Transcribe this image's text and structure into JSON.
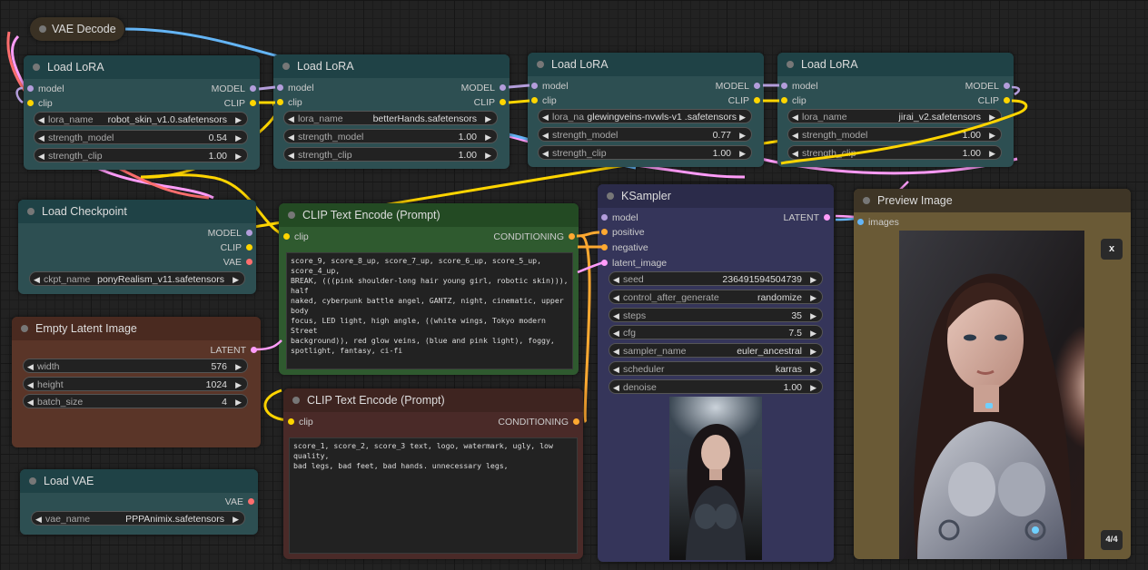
{
  "colors": {
    "model": "#b39ddb",
    "clip": "#ffd500",
    "vae": "#ff6e6e",
    "latent": "#ff9cf9",
    "conditioning": "#ffa931",
    "image": "#64b5f6"
  },
  "vae_decode": {
    "title": "VAE Decode"
  },
  "lora1": {
    "title": "Load LoRA",
    "in_model": "model",
    "in_clip": "clip",
    "out_model": "MODEL",
    "out_clip": "CLIP",
    "w_name_label": "lora_name",
    "w_name_value": "robot_skin_v1.0.safetensors",
    "w_sm_label": "strength_model",
    "w_sm_value": "0.54",
    "w_sc_label": "strength_clip",
    "w_sc_value": "1.00"
  },
  "lora2": {
    "title": "Load LoRA",
    "in_model": "model",
    "in_clip": "clip",
    "out_model": "MODEL",
    "out_clip": "CLIP",
    "w_name_label": "lora_name",
    "w_name_value": "betterHands.safetensors",
    "w_sm_label": "strength_model",
    "w_sm_value": "1.00",
    "w_sc_label": "strength_clip",
    "w_sc_value": "1.00"
  },
  "lora3": {
    "title": "Load LoRA",
    "in_model": "model",
    "in_clip": "clip",
    "out_model": "MODEL",
    "out_clip": "CLIP",
    "w_name_label": "lora_na",
    "w_name_value": "glewingveins-nvwls-v1 .safetensors",
    "w_sm_label": "strength_model",
    "w_sm_value": "0.77",
    "w_sc_label": "strength_clip",
    "w_sc_value": "1.00"
  },
  "lora4": {
    "title": "Load LoRA",
    "in_model": "model",
    "in_clip": "clip",
    "out_model": "MODEL",
    "out_clip": "CLIP",
    "w_name_label": "lora_name",
    "w_name_value": "jirai_v2.safetensors",
    "w_sm_label": "strength_model",
    "w_sm_value": "1.00",
    "w_sc_label": "strength_clip",
    "w_sc_value": "1.00"
  },
  "checkpoint": {
    "title": "Load Checkpoint",
    "out_model": "MODEL",
    "out_clip": "CLIP",
    "out_vae": "VAE",
    "w_label": "ckpt_name",
    "w_value": "ponyRealism_v11.safetensors"
  },
  "latent": {
    "title": "Empty Latent Image",
    "out_latent": "LATENT",
    "w_width_label": "width",
    "w_width_value": "576",
    "w_height_label": "height",
    "w_height_value": "1024",
    "w_batch_label": "batch_size",
    "w_batch_value": "4"
  },
  "vae_loader": {
    "title": "Load VAE",
    "out_vae": "VAE",
    "w_label": "vae_name",
    "w_value": "PPPAnimix.safetensors"
  },
  "clip_pos": {
    "title": "CLIP Text Encode (Prompt)",
    "in_clip": "clip",
    "out_cond": "CONDITIONING",
    "text": "score_9, score_8_up, score_7_up, score_6_up, score_5_up, score_4_up,\nBREAK, (((pink shoulder-long hair young girl, robotic skin))), half\nnaked, cyberpunk battle angel, GANTZ, night, cinematic, upper body\nfocus, LED light, high angle, ((white wings, Tokyo modern Street\nbackground)), red glow veins, (blue and pink light), foggy,\nspotlight, fantasy, ci-fi"
  },
  "clip_neg": {
    "title": "CLIP Text Encode (Prompt)",
    "in_clip": "clip",
    "out_cond": "CONDITIONING",
    "text": "score_1, score_2, score_3 text, logo, watermark, ugly, low quality,\nbad legs, bad feet, bad hands. unnecessary legs,"
  },
  "ksampler": {
    "title": "KSampler",
    "in_model": "model",
    "in_pos": "positive",
    "in_neg": "negative",
    "in_latent": "latent_image",
    "out_latent": "LATENT",
    "widgets": [
      {
        "label": "seed",
        "value": "236491594504739"
      },
      {
        "label": "control_after_generate",
        "value": "randomize"
      },
      {
        "label": "steps",
        "value": "35"
      },
      {
        "label": "cfg",
        "value": "7.5"
      },
      {
        "label": "sampler_name",
        "value": "euler_ancestral"
      },
      {
        "label": "scheduler",
        "value": "karras"
      },
      {
        "label": "denoise",
        "value": "1.00"
      }
    ]
  },
  "preview": {
    "title": "Preview Image",
    "in_images": "images",
    "close_label": "x",
    "counter": "4/4"
  }
}
